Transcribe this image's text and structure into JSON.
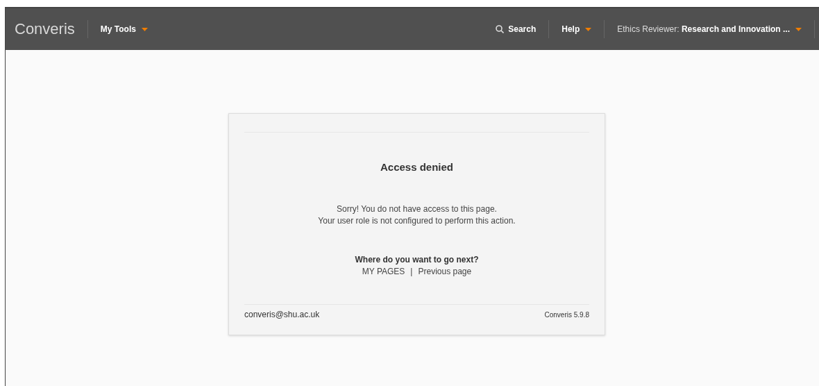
{
  "header": {
    "logo": "Converis",
    "menu": [
      {
        "label": "My Tools"
      }
    ],
    "right": [
      {
        "kind": "search",
        "label": "Search"
      },
      {
        "kind": "menu",
        "label": "Help"
      },
      {
        "kind": "role",
        "label": "Ethics Reviewer: **Research and Innovation ...**"
      }
    ]
  },
  "card": {
    "title": "Access denied",
    "message": [
      "Sorry! You do not have access to this page.",
      "Your user role is not configured to perform this action."
    ],
    "next_heading": "Where do you want to go next?",
    "links": [
      {
        "label": "MY PAGES"
      },
      {
        "label": "Previous page"
      }
    ],
    "separator": "|",
    "email": "converis@shu.ac.uk",
    "version": "Converis 5.9.8"
  }
}
